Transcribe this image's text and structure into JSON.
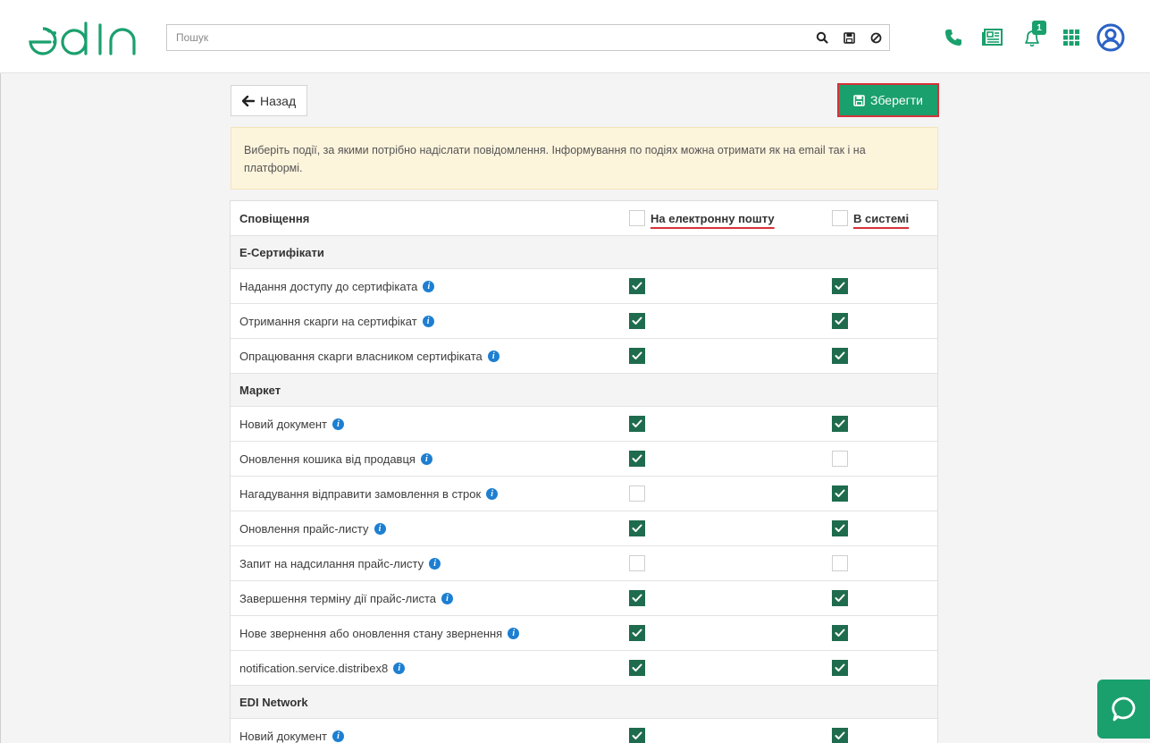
{
  "header": {
    "logo_text": "edin",
    "search": {
      "placeholder": "Пошук",
      "value": ""
    },
    "notifications_count": "1",
    "colors": {
      "accent": "#1aa06d",
      "icon": "#1aa06d",
      "profile": "#2a63c6"
    },
    "icons": [
      "search-icon",
      "save-icon",
      "block-icon",
      "phone-icon",
      "news-icon",
      "bell-icon",
      "apps-grid-icon",
      "profile-icon"
    ]
  },
  "toolbar": {
    "back_label": "Назад",
    "save_label": "Зберегти"
  },
  "info_text": "Виберіть події, за якими потрібно надіслати повідомлення. Інформування по подіях можна отримати як на email так і на платформі.",
  "table": {
    "columns": {
      "name": "Сповіщення",
      "email": "На електронну пошту",
      "system": "В системі"
    },
    "groups": [
      {
        "title": "Е-Сертифікати",
        "items": [
          {
            "label": "Надання доступу до сертифіката",
            "email": true,
            "system": true
          },
          {
            "label": "Отримання скарги на сертифікат",
            "email": true,
            "system": true
          },
          {
            "label": "Опрацювання скарги власником сертифіката",
            "email": true,
            "system": true
          }
        ]
      },
      {
        "title": "Маркет",
        "items": [
          {
            "label": "Новий документ",
            "email": true,
            "system": true
          },
          {
            "label": "Оновлення кошика від продавця",
            "email": true,
            "system": false
          },
          {
            "label": "Нагадування відправити замовлення в строк",
            "email": false,
            "system": true
          },
          {
            "label": "Оновлення прайс-листу",
            "email": true,
            "system": true
          },
          {
            "label": "Запит на надсилання прайс-листу",
            "email": false,
            "system": false
          },
          {
            "label": "Завершення терміну дії прайс-листа",
            "email": true,
            "system": true
          },
          {
            "label": "Нове звернення або оновлення стану звернення",
            "email": true,
            "system": true
          },
          {
            "label": "notification.service.distribex8",
            "email": true,
            "system": true
          }
        ]
      },
      {
        "title": "EDI Network",
        "items": [
          {
            "label": "Новий документ",
            "email": true,
            "system": true
          }
        ]
      }
    ]
  }
}
